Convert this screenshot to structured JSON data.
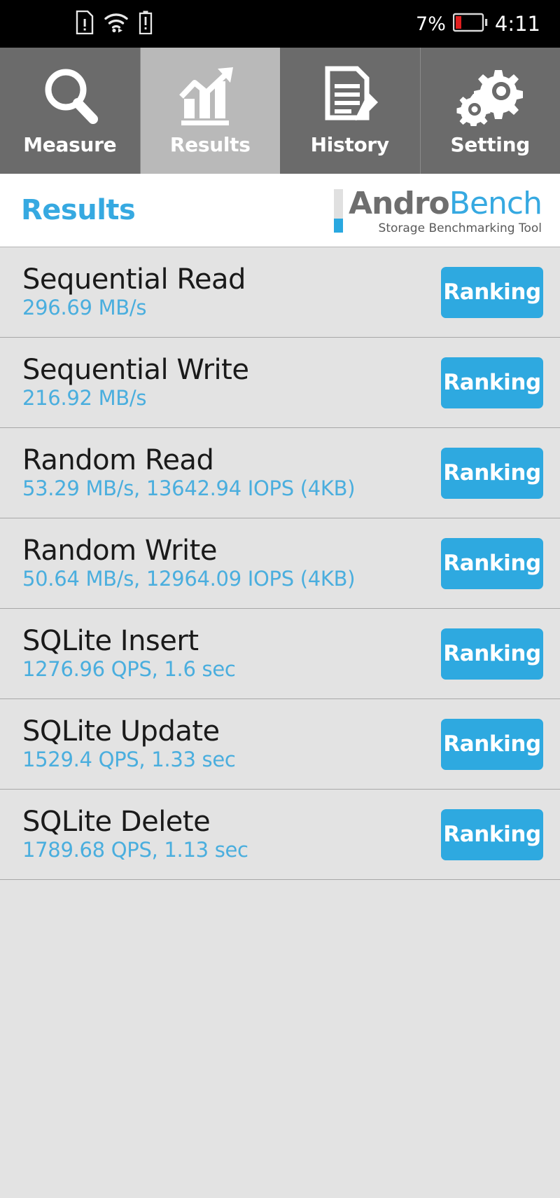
{
  "statusbar": {
    "icons": [
      "sim-card-alert-icon",
      "wifi-icon",
      "battery-alert-icon"
    ],
    "battery_percent": "7%",
    "battery_icon": "battery-low-icon",
    "time": "4:11"
  },
  "tabs": [
    {
      "label": "Measure",
      "icon": "magnifier-icon",
      "active": false
    },
    {
      "label": "Results",
      "icon": "bar-chart-icon",
      "active": true
    },
    {
      "label": "History",
      "icon": "document-pen-icon",
      "active": false
    },
    {
      "label": "Setting",
      "icon": "gears-icon",
      "active": false
    }
  ],
  "header": {
    "title": "Results",
    "logo": {
      "word1": "Andro",
      "word2": "Bench",
      "tagline": "Storage Benchmarking Tool"
    }
  },
  "results": {
    "ranking_label": "Ranking",
    "rows": [
      {
        "name": "Sequential Read",
        "value": "296.69 MB/s"
      },
      {
        "name": "Sequential Write",
        "value": "216.92 MB/s"
      },
      {
        "name": "Random Read",
        "value": "53.29 MB/s, 13642.94 IOPS (4KB)"
      },
      {
        "name": "Random Write",
        "value": "50.64 MB/s, 12964.09 IOPS (4KB)"
      },
      {
        "name": "SQLite Insert",
        "value": "1276.96 QPS, 1.6 sec"
      },
      {
        "name": "SQLite Update",
        "value": "1529.4 QPS, 1.33 sec"
      },
      {
        "name": "SQLite Delete",
        "value": "1789.68 QPS, 1.13 sec"
      }
    ]
  },
  "colors": {
    "accent_blue": "#2ea9e0",
    "value_blue": "#4aaede",
    "list_bg": "#e3e3e3",
    "tab_bg": "#6b6b6b",
    "tab_active_bg": "#b9b9b9",
    "statusbar_bg": "#000000",
    "battery_warn": "#e02020"
  }
}
